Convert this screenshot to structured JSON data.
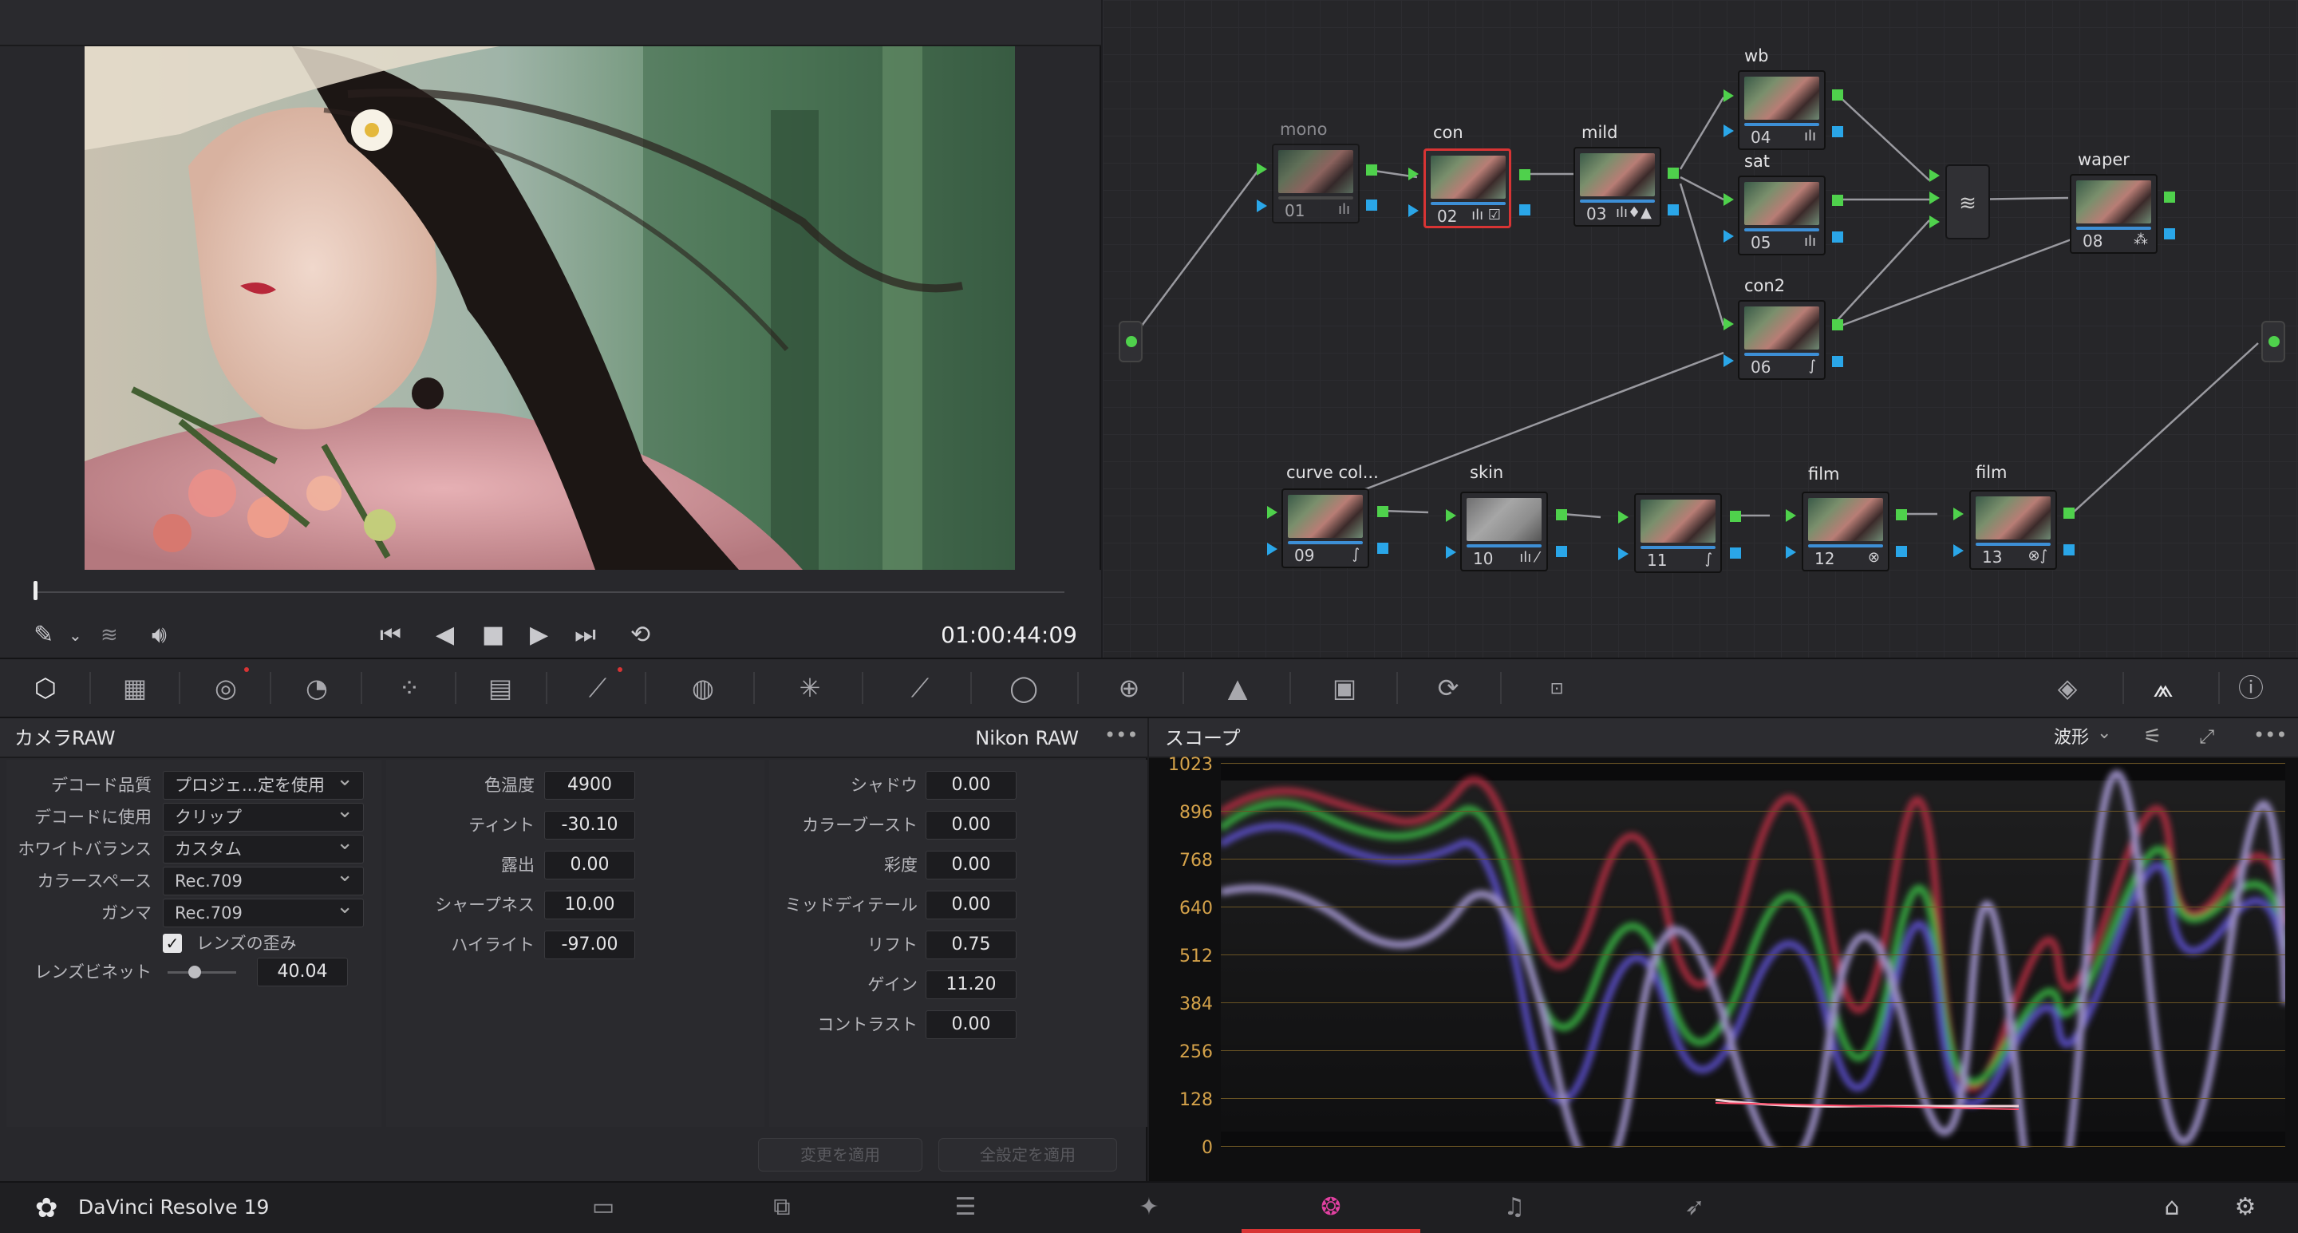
{
  "viewer": {
    "timecode": "01:00:44:09",
    "playback_progress": 0.01
  },
  "nodes": [
    {
      "id": "01",
      "label": "mono"
    },
    {
      "id": "02",
      "label": "con"
    },
    {
      "id": "03",
      "label": "mild"
    },
    {
      "id": "04",
      "label": "wb"
    },
    {
      "id": "05",
      "label": "sat"
    },
    {
      "id": "06",
      "label": "con2"
    },
    {
      "id": "08",
      "label": "waper"
    },
    {
      "id": "09",
      "label": "curve col..."
    },
    {
      "id": "10",
      "label": "skin"
    },
    {
      "id": "11",
      "label": ""
    },
    {
      "id": "12",
      "label": "film"
    },
    {
      "id": "13",
      "label": "film"
    }
  ],
  "raw_panel": {
    "title": "カメラRAW",
    "camera": "Nikon RAW",
    "more": "•••",
    "left": [
      {
        "label": "デコード品質",
        "value": "プロジェ...定を使用"
      },
      {
        "label": "デコードに使用",
        "value": "クリップ"
      },
      {
        "label": "ホワイトバランス",
        "value": "カスタム"
      },
      {
        "label": "カラースペース",
        "value": "Rec.709"
      },
      {
        "label": "ガンマ",
        "value": "Rec.709"
      }
    ],
    "lens_distortion": "レンズの歪み",
    "vignette_label": "レンズビネット",
    "vignette_value": "40.04",
    "mid": [
      {
        "label": "色温度",
        "value": "4900"
      },
      {
        "label": "ティント",
        "value": "-30.10"
      },
      {
        "label": "露出",
        "value": "0.00"
      },
      {
        "label": "シャープネス",
        "value": "10.00"
      },
      {
        "label": "ハイライト",
        "value": "-97.00"
      }
    ],
    "right": [
      {
        "label": "シャドウ",
        "value": "0.00"
      },
      {
        "label": "カラーブースト",
        "value": "0.00"
      },
      {
        "label": "彩度",
        "value": "0.00"
      },
      {
        "label": "ミッドディテール",
        "value": "0.00"
      },
      {
        "label": "リフト",
        "value": "0.75"
      },
      {
        "label": "ゲイン",
        "value": "11.20"
      },
      {
        "label": "コントラスト",
        "value": "0.00"
      }
    ],
    "apply_changes": "変更を適用",
    "apply_all": "全設定を適用"
  },
  "scope": {
    "title": "スコープ",
    "mode": "波形",
    "more": "•••",
    "ticks": [
      "1023",
      "896",
      "768",
      "640",
      "512",
      "384",
      "256",
      "128",
      "0"
    ]
  },
  "footer": {
    "app_name": "DaVinci Resolve 19"
  },
  "colors": {
    "accent": "#d83434",
    "pin_green": "#4fd14c",
    "pin_blue": "#2aa6e8",
    "graticule": "#d4a24a"
  }
}
